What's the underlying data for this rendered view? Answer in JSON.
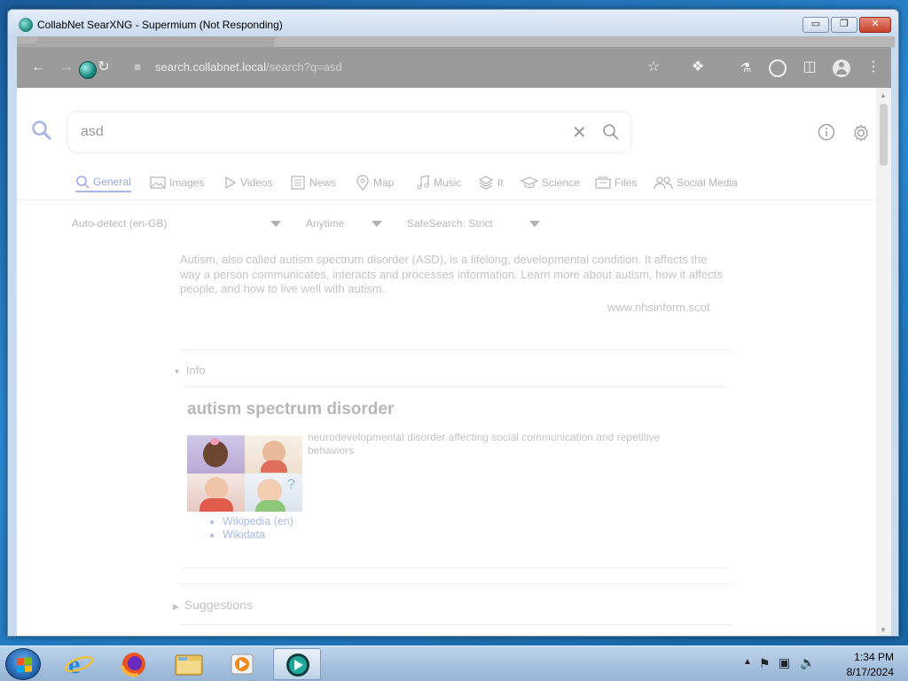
{
  "window": {
    "title": "CollabNet SearXNG - Supermium (Not Responding)",
    "minimize": "▭",
    "maximize": "❐",
    "close": "✕"
  },
  "browser": {
    "url_host": "search.collabnet.local",
    "url_path": "/search?q=asd"
  },
  "search": {
    "query": "asd",
    "clear_label": "✕"
  },
  "categories": [
    {
      "label": "General",
      "icon": "search-icon",
      "active": true
    },
    {
      "label": "Images",
      "icon": "image-icon"
    },
    {
      "label": "Videos",
      "icon": "play-icon"
    },
    {
      "label": "News",
      "icon": "newspaper-icon"
    },
    {
      "label": "Map",
      "icon": "map-pin-icon"
    },
    {
      "label": "Music",
      "icon": "music-note-icon"
    },
    {
      "label": "It",
      "icon": "layers-icon"
    },
    {
      "label": "Science",
      "icon": "graduation-cap-icon"
    },
    {
      "label": "Files",
      "icon": "folder-icon"
    },
    {
      "label": "Social Media",
      "icon": "people-icon"
    }
  ],
  "filters": {
    "language": "Auto-detect (en-GB)",
    "time": "Anytime",
    "safesearch": "SafeSearch: Strict"
  },
  "result": {
    "snippet": "Autism, also called autism spectrum disorder (ASD), is a lifelong, developmental condition. It affects the way a person communicates, interacts and processes information. Learn more about autism, how it affects people, and how to live well with autism.",
    "source": "www.nhsinform.scot"
  },
  "infobox": {
    "toggle_label": "Info",
    "title": "autism spectrum disorder",
    "description": "neurodevelopmental disorder affecting social communication and repetitive behaviors",
    "links": [
      "Wikipedia (en)",
      "Wikidata"
    ]
  },
  "suggestions": {
    "label": "Suggestions"
  },
  "taskbar": {
    "time": "1:34 PM",
    "date": "8/17/2024",
    "apps": [
      "internet-explorer-icon",
      "firefox-icon",
      "file-explorer-icon",
      "media-player-icon",
      "supermium-icon"
    ]
  },
  "colors": {
    "accent": "#9aa7dd",
    "link": "#a9bce4",
    "muted_text": "#c4c4c4"
  }
}
